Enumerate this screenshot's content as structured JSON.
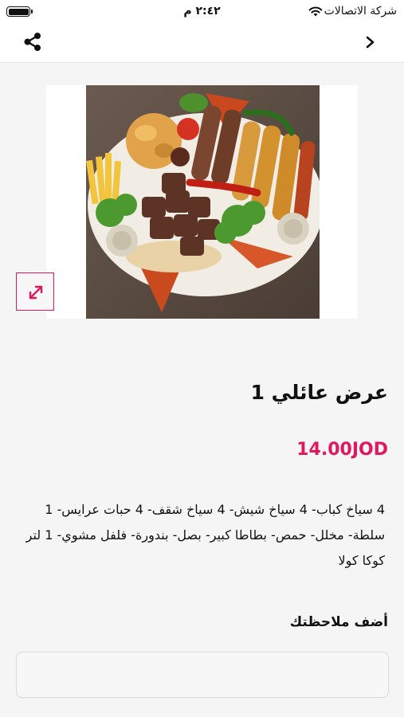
{
  "status_bar": {
    "carrier": "شركة الاتصالات",
    "time": "٢:٤٢ م"
  },
  "product": {
    "title": "عرض عائلي 1",
    "price": "14.00JOD",
    "description": "4 سياخ كباب- 4 سياخ شيش- 4 سياخ شقف- 4 حبات عرايس- 1 سلطة- مخلل- حمص- بطاطا كبير- بصل- بندورة- فلفل مشوي- 1 لتر كوكا كولا"
  },
  "notes": {
    "label": "أضف ملاحظتك",
    "value": ""
  },
  "colors": {
    "accent": "#e0195a",
    "background": "#f5f5f5"
  },
  "icons": {
    "share": "share-icon",
    "back": "chevron-right-icon",
    "expand": "expand-icon",
    "wifi": "wifi-icon",
    "battery": "battery-icon"
  }
}
